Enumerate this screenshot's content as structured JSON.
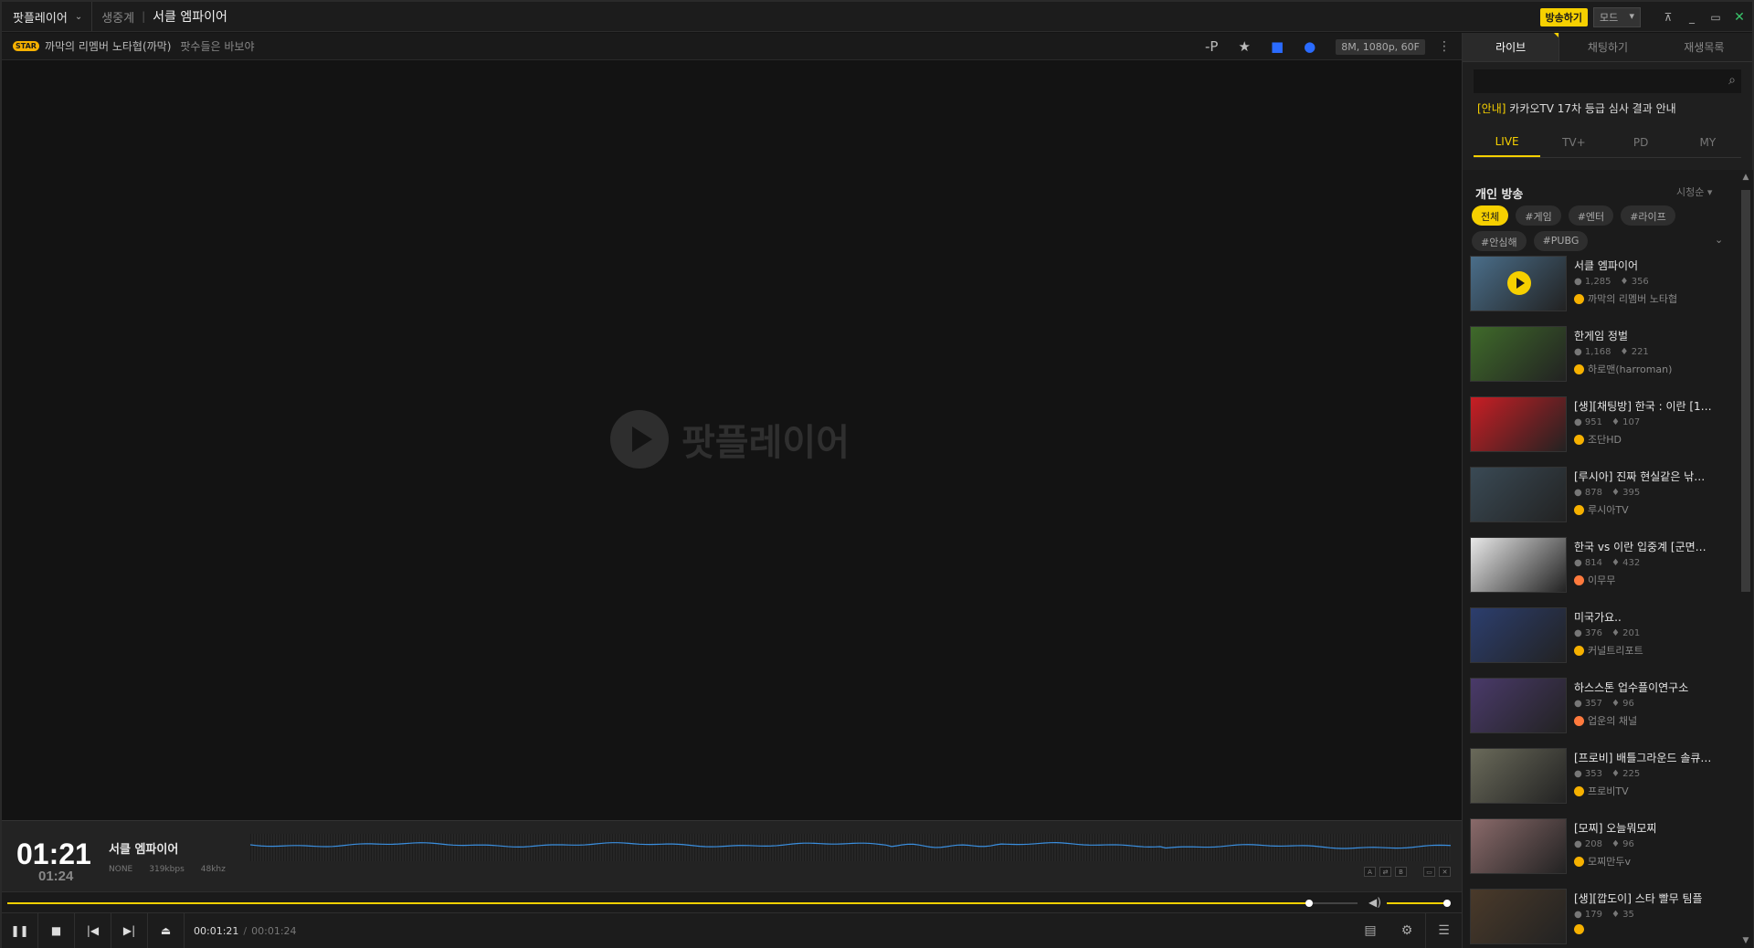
{
  "titlebar": {
    "brand": "팟플레이어",
    "crumb": "생중계",
    "title": "서클 엠파이어",
    "broadcast_btn": "방송하기",
    "mode": "모드"
  },
  "infobar": {
    "badge": "STAR",
    "bj_name": "까막의 리멤버 노타협(까막)",
    "description": "팟수들은 바보야",
    "quality": "8M, 1080p, 60F"
  },
  "video": {
    "logo_text": "팟플레이어"
  },
  "panel": {
    "time_big": "01:21",
    "time_small": "01:24",
    "title": "서클 엠파이어",
    "meta": [
      "NONE",
      "319kbps",
      "48khz"
    ],
    "mini": [
      "A",
      "B"
    ]
  },
  "progress": {
    "seek_fraction": 0.9642,
    "volume_fraction": 1.0
  },
  "controls": {
    "current": "00:01:21",
    "total": "00:01:24"
  },
  "sidebar": {
    "tabs": [
      "라이브",
      "채팅하기",
      "재생목록"
    ],
    "search_placeholder": "",
    "notice_tag": "[안내]",
    "notice_text": "카카오TV 17차 등급 심사 결과 안내",
    "subtabs": [
      "LIVE",
      "TV+",
      "PD",
      "MY"
    ],
    "section": "개인 방송",
    "sort": "시청순 ▾",
    "filters": [
      "전체",
      "#게임",
      "#엔터",
      "#라이프",
      "#안심해",
      "#PUBG"
    ],
    "items": [
      {
        "title": "서클 엠파이어",
        "viewers": "1,285",
        "likes": "356",
        "owner": "까막의 리멤버 노타협",
        "thumb": "#4a6e8a",
        "dot": "yellow"
      },
      {
        "title": "한게임 정벌",
        "viewers": "1,168",
        "likes": "221",
        "owner": "하로맨(harroman)",
        "thumb": "#3f6a2a",
        "dot": "yellow"
      },
      {
        "title": "[생][채팅방] 한국 : 이란 [1…",
        "viewers": "951",
        "likes": "107",
        "owner": "조단HD",
        "thumb": "#c81e24",
        "dot": "yellow"
      },
      {
        "title": "[루시아] 진짜 현실같은 낚…",
        "viewers": "878",
        "likes": "395",
        "owner": "루시아TV",
        "thumb": "#3a4a55",
        "dot": "yellow"
      },
      {
        "title": "한국 vs 이란 입중계 [군면…",
        "viewers": "814",
        "likes": "432",
        "owner": "이무무",
        "thumb": "#e8e8e8",
        "dot": "orange"
      },
      {
        "title": "미국가요..",
        "viewers": "376",
        "likes": "201",
        "owner": "커널트리포트",
        "thumb": "#2c3e6e",
        "dot": "yellow"
      },
      {
        "title": "하스스톤 업수플이연구소",
        "viewers": "357",
        "likes": "96",
        "owner": "업운의 채널",
        "thumb": "#4a3a6a",
        "dot": "orange"
      },
      {
        "title": "[프로비] 배틀그라운드 솔큐…",
        "viewers": "353",
        "likes": "225",
        "owner": "프로비TV",
        "thumb": "#6a6a5a",
        "dot": "yellow"
      },
      {
        "title": "[모찌] 오늘뭐모찌",
        "viewers": "208",
        "likes": "96",
        "owner": "모찌만두v",
        "thumb": "#8a6a6a",
        "dot": "yellow"
      },
      {
        "title": "[생][깝도이] 스타 빨무 팀플",
        "viewers": "179",
        "likes": "35",
        "owner": "",
        "thumb": "#4a3a2a",
        "dot": "yellow"
      }
    ]
  }
}
